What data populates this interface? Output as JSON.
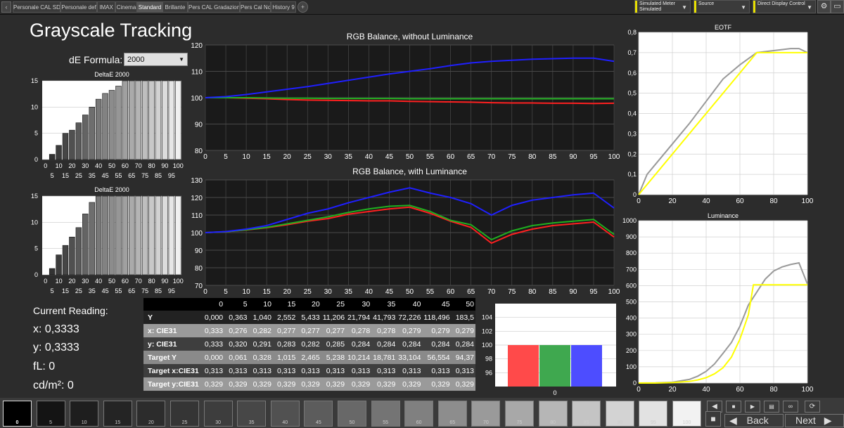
{
  "tabs": {
    "items": [
      "Personale CAL SDR",
      "Personale def",
      "IMAX",
      "Cinema",
      "Standard",
      "Brillante",
      "Pers CAL Gradazione",
      "Pers Cal No",
      "History 9"
    ],
    "active": "Standard",
    "add_label": "+",
    "left_arrow": "‹"
  },
  "toolbar": {
    "meter_line1": "Simulated Meter",
    "meter_line2": "Simulated",
    "source_label": "Source",
    "display_control_label": "Direct Display Control",
    "settings_icon": "gear-icon",
    "window_icon": "window-icon"
  },
  "page": {
    "title": "Grayscale Tracking",
    "de_formula_label": "dE Formula:",
    "de_formula_value": "2000"
  },
  "current": {
    "heading": "Current Reading:",
    "x": "x: 0,3333",
    "y": "y: 0,3333",
    "fl": "fL: 0",
    "cd": "cd/m²: 0"
  },
  "table": {
    "headers": [
      "0",
      "5",
      "10",
      "15",
      "20",
      "25",
      "30",
      "35",
      "40",
      "45",
      "50"
    ],
    "rows": [
      {
        "label": "Y",
        "values": [
          "0,000",
          "0,363",
          "1,040",
          "2,552",
          "5,433",
          "11,206",
          "21,794",
          "41,793",
          "72,226",
          "118,496",
          "183,5"
        ]
      },
      {
        "label": "x: CIE31",
        "values": [
          "0,333",
          "0,276",
          "0,282",
          "0,277",
          "0,277",
          "0,277",
          "0,278",
          "0,278",
          "0,279",
          "0,279",
          "0,279"
        ]
      },
      {
        "label": "y: CIE31",
        "values": [
          "0,333",
          "0,320",
          "0,291",
          "0,283",
          "0,282",
          "0,285",
          "0,284",
          "0,284",
          "0,284",
          "0,284",
          "0,284"
        ]
      },
      {
        "label": "Target Y",
        "values": [
          "0,000",
          "0,061",
          "0,328",
          "1,015",
          "2,465",
          "5,238",
          "10,214",
          "18,781",
          "33,104",
          "56,554",
          "94,37"
        ]
      },
      {
        "label": "Target x:CIE31",
        "values": [
          "0,313",
          "0,313",
          "0,313",
          "0,313",
          "0,313",
          "0,313",
          "0,313",
          "0,313",
          "0,313",
          "0,313",
          "0,313"
        ]
      },
      {
        "label": "Target y:CIE31",
        "values": [
          "0,329",
          "0,329",
          "0,329",
          "0,329",
          "0,329",
          "0,329",
          "0,329",
          "0,329",
          "0,329",
          "0,329",
          "0,329"
        ]
      }
    ]
  },
  "patches": {
    "labels": [
      "0",
      "5",
      "10",
      "15",
      "20",
      "25",
      "30",
      "35",
      "40",
      "45",
      "50",
      "55",
      "60",
      "65",
      "70",
      "75",
      "80",
      "85",
      "90",
      "95",
      "100"
    ],
    "colors": [
      "#000000",
      "#141414",
      "#1e1e1e",
      "#242424",
      "#2c2c2c",
      "#353535",
      "#3d3d3d",
      "#474747",
      "#515151",
      "#5c5c5c",
      "#686868",
      "#747474",
      "#808080",
      "#8d8d8d",
      "#9a9a9a",
      "#a8a8a8",
      "#b6b6b6",
      "#c4c4c4",
      "#d3d3d3",
      "#e2e2e2",
      "#f2f2f2"
    ],
    "selected": "0"
  },
  "nav": {
    "back_label": "Back",
    "next_label": "Next",
    "back_icon": "left-arrow-icon",
    "next_icon": "right-arrow-icon",
    "stop_icon": "stop-icon",
    "play_icon": "play-icon",
    "record_icon": "record-icon",
    "save_icon": "save-icon",
    "loop_icon": "loop-icon",
    "refresh_icon": "refresh-icon"
  },
  "chart_data": [
    {
      "id": "de1",
      "type": "bar",
      "title": "DeltaE 2000",
      "ylim": [
        0,
        15
      ],
      "yticks": [
        0,
        5,
        10,
        15
      ],
      "xticks_top": [
        "0",
        "10",
        "20",
        "30",
        "40",
        "50",
        "60",
        "70",
        "80",
        "90",
        "100"
      ],
      "xticks_bottom": [
        "5",
        "15",
        "25",
        "35",
        "45",
        "55",
        "65",
        "75",
        "85",
        "95"
      ],
      "categories": [
        "0",
        "5",
        "10",
        "15",
        "20",
        "25",
        "30",
        "35",
        "40",
        "45",
        "50",
        "55",
        "60",
        "65",
        "70",
        "75",
        "80",
        "85",
        "90",
        "95",
        "100"
      ],
      "values": [
        0,
        1,
        2.7,
        5,
        5.6,
        7,
        8.5,
        10,
        11.5,
        12.6,
        13.2,
        14,
        15,
        15,
        15,
        15,
        15,
        15,
        15,
        15,
        15
      ]
    },
    {
      "id": "de2",
      "type": "bar",
      "title": "DeltaE 2000",
      "ylim": [
        0,
        15
      ],
      "yticks": [
        0,
        5,
        10,
        15
      ],
      "xticks_top": [
        "0",
        "10",
        "20",
        "30",
        "40",
        "50",
        "60",
        "70",
        "80",
        "90",
        "100"
      ],
      "xticks_bottom": [
        "5",
        "15",
        "25",
        "35",
        "45",
        "55",
        "65",
        "75",
        "85",
        "95"
      ],
      "categories": [
        "0",
        "5",
        "10",
        "15",
        "20",
        "25",
        "30",
        "35",
        "40",
        "45",
        "50",
        "55",
        "60",
        "65",
        "70",
        "75",
        "80",
        "85",
        "90",
        "95",
        "100"
      ],
      "values": [
        0,
        1.2,
        3.8,
        5.6,
        7.2,
        9,
        11.6,
        13.8,
        15,
        15,
        15,
        15,
        15,
        15,
        15,
        15,
        15,
        15,
        15,
        15,
        15
      ]
    },
    {
      "id": "rgb1",
      "type": "line",
      "title": "RGB Balance, without Luminance",
      "xlim": [
        0,
        100
      ],
      "ylim": [
        80,
        120
      ],
      "yticks": [
        80,
        90,
        100,
        110,
        120
      ],
      "x": [
        0,
        5,
        10,
        15,
        20,
        25,
        30,
        35,
        40,
        45,
        50,
        55,
        60,
        65,
        70,
        75,
        80,
        85,
        90,
        95,
        100
      ],
      "series": [
        {
          "color": "#ff2020",
          "values": [
            100,
            100,
            99.8,
            99.6,
            99.3,
            99.1,
            99,
            98.9,
            98.8,
            98.8,
            98.6,
            98.5,
            98.4,
            98.3,
            98.1,
            98,
            98,
            97.9,
            97.9,
            97.8,
            97.9
          ]
        },
        {
          "color": "#20b020",
          "values": [
            100,
            100,
            100,
            99.9,
            99.8,
            99.8,
            99.7,
            99.7,
            99.7,
            99.7,
            99.6,
            99.6,
            99.6,
            99.6,
            99.6,
            99.6,
            99.6,
            99.6,
            99.6,
            99.6,
            99.6
          ]
        },
        {
          "color": "#1f1fff",
          "values": [
            100,
            100.4,
            101.2,
            102.2,
            103.2,
            104.2,
            105.4,
            106.6,
            107.8,
            109,
            110,
            111,
            112.2,
            113.2,
            113.8,
            114.2,
            114.6,
            114.8,
            115,
            115,
            113.8
          ]
        }
      ]
    },
    {
      "id": "rgb2",
      "type": "line",
      "title": "RGB Balance, with Luminance",
      "xlim": [
        0,
        100
      ],
      "ylim": [
        70,
        130
      ],
      "yticks": [
        70,
        80,
        90,
        100,
        110,
        120,
        130
      ],
      "x": [
        0,
        5,
        10,
        15,
        20,
        25,
        30,
        35,
        40,
        45,
        50,
        55,
        60,
        65,
        70,
        75,
        80,
        85,
        90,
        95,
        100
      ],
      "series": [
        {
          "color": "#ff2020",
          "values": [
            100,
            100.5,
            101.5,
            102.8,
            104.5,
            106.5,
            108,
            110.5,
            112,
            113.5,
            114.5,
            111,
            106.5,
            103,
            94,
            99,
            102,
            104,
            105,
            106,
            97.5
          ]
        },
        {
          "color": "#20b020",
          "values": [
            100,
            100.5,
            101.6,
            103,
            105,
            107,
            109,
            111.5,
            113.5,
            115,
            115.5,
            112,
            107,
            104.5,
            96,
            101,
            104,
            105.5,
            106.5,
            107.5,
            99
          ]
        },
        {
          "color": "#1f1fff",
          "values": [
            100,
            100.6,
            102,
            104,
            107.5,
            111,
            113.5,
            117,
            120,
            123,
            125.5,
            122.5,
            120,
            116.5,
            110,
            115.5,
            118.5,
            120,
            121.5,
            122.5,
            114
          ]
        }
      ]
    },
    {
      "id": "eotf",
      "type": "line",
      "title": "EOTF",
      "xlim": [
        0,
        100
      ],
      "ylim": [
        0,
        0.8
      ],
      "xticks": [
        0,
        20,
        40,
        60,
        80,
        100
      ],
      "yticks_labels": [
        "0",
        "0,1",
        "0,2",
        "0,3",
        "0,4",
        "0,5",
        "0,6",
        "0,7",
        "0,8"
      ],
      "series": [
        {
          "color": "#999999",
          "x": [
            0,
            5,
            10,
            20,
            30,
            40,
            50,
            60,
            70,
            80,
            90,
            95,
            100
          ],
          "values": [
            0,
            0.1,
            0.15,
            0.25,
            0.35,
            0.46,
            0.57,
            0.64,
            0.7,
            0.71,
            0.72,
            0.72,
            0.7
          ]
        },
        {
          "color": "#ffff00",
          "x": [
            0,
            70,
            100
          ],
          "values": [
            0,
            0.7,
            0.7
          ]
        }
      ]
    },
    {
      "id": "lum",
      "type": "line",
      "title": "Luminance",
      "xlim": [
        0,
        100
      ],
      "ylim": [
        0,
        1000
      ],
      "xticks": [
        0,
        20,
        40,
        60,
        80,
        100
      ],
      "yticks": [
        0,
        100,
        200,
        300,
        400,
        500,
        600,
        700,
        800,
        900,
        1000
      ],
      "series": [
        {
          "color": "#999999",
          "x": [
            0,
            10,
            20,
            30,
            35,
            40,
            45,
            50,
            55,
            60,
            65,
            70,
            75,
            80,
            85,
            90,
            95,
            100
          ],
          "values": [
            0,
            1,
            5,
            22,
            42,
            72,
            118,
            183,
            250,
            350,
            480,
            560,
            640,
            690,
            715,
            730,
            740,
            610
          ]
        },
        {
          "color": "#ffff00",
          "x": [
            0,
            10,
            20,
            30,
            35,
            40,
            45,
            50,
            55,
            60,
            65,
            68,
            100
          ],
          "values": [
            0,
            0.1,
            2.5,
            10,
            19,
            33,
            57,
            94,
            160,
            270,
            420,
            605,
            605
          ]
        }
      ]
    },
    {
      "id": "rgbbars",
      "type": "bar",
      "categories": [
        "R",
        "G",
        "B"
      ],
      "xtick": "0",
      "ylim": [
        94,
        106
      ],
      "yticks": [
        96,
        98,
        100,
        102,
        104
      ],
      "values": [
        100,
        100,
        100
      ],
      "colors": [
        "#ff4a4a",
        "#3fa84f",
        "#4d4dff"
      ]
    }
  ]
}
